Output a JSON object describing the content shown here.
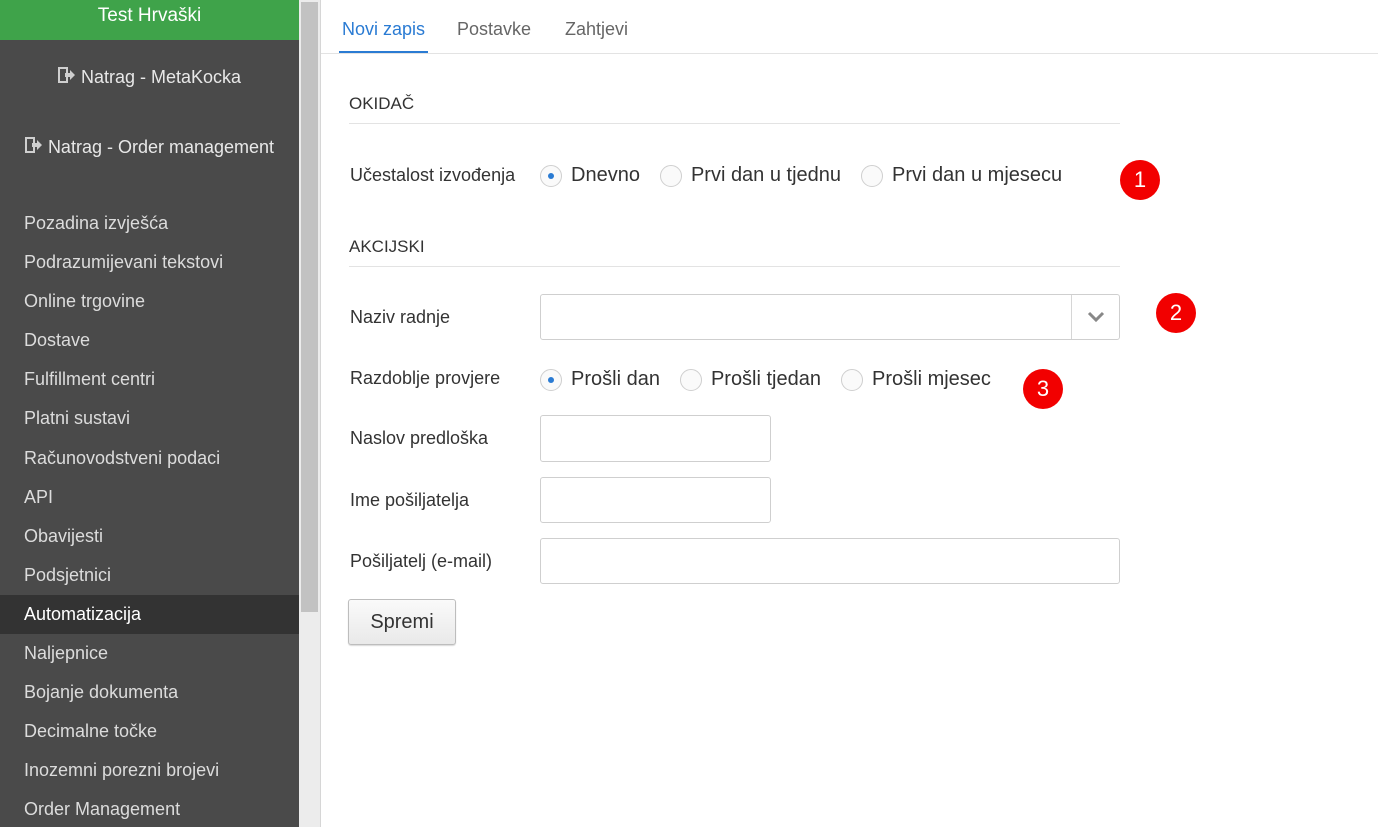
{
  "sidebar": {
    "title": "Test Hrvaški",
    "back_links": [
      {
        "label": "Natrag - MetaKocka"
      },
      {
        "label": "Natrag - Order management"
      }
    ],
    "items": [
      {
        "label": "Pozadina izvješća"
      },
      {
        "label": "Podrazumijevani tekstovi"
      },
      {
        "label": "Online trgovine"
      },
      {
        "label": "Dostave"
      },
      {
        "label": "Fulfillment centri"
      },
      {
        "label": "Platni sustavi"
      },
      {
        "label": "Računovodstveni podaci"
      },
      {
        "label": "API"
      },
      {
        "label": "Obavijesti"
      },
      {
        "label": "Podsjetnici"
      },
      {
        "label": "Automatizacija"
      },
      {
        "label": "Naljepnice"
      },
      {
        "label": "Bojanje dokumenta"
      },
      {
        "label": "Decimalne točke"
      },
      {
        "label": "Inozemni porezni brojevi"
      },
      {
        "label": "Order Management"
      }
    ],
    "active_item": "Automatizacija"
  },
  "tabs": [
    {
      "label": "Novi zapis"
    },
    {
      "label": "Postavke"
    },
    {
      "label": "Zahtjevi"
    }
  ],
  "active_tab": "Novi zapis",
  "form": {
    "trigger_section": "OKIDAČ",
    "frequency_label": "Učestalost izvođenja",
    "frequency_options": [
      "Dnevno",
      "Prvi dan u tjednu",
      "Prvi dan u mjesecu"
    ],
    "frequency_selected": "Dnevno",
    "action_section": "AKCIJSKI",
    "action_name_label": "Naziv radnje",
    "action_name_value": "",
    "period_label": "Razdoblje provjere",
    "period_options": [
      "Prošli dan",
      "Prošli tjedan",
      "Prošli mjesec"
    ],
    "period_selected": "Prošli dan",
    "template_title_label": "Naslov predloška",
    "template_title_value": "",
    "sender_name_label": "Ime pošiljatelja",
    "sender_name_value": "",
    "sender_email_label": "Pošiljatelj (e-mail)",
    "sender_email_value": "",
    "save_label": "Spremi"
  },
  "badges": [
    "1",
    "2",
    "3"
  ],
  "colors": {
    "sidebar_bg": "#4a4a4a",
    "sidebar_header": "#3fa34a",
    "accent": "#2a7bd3",
    "badge": "#f20000"
  }
}
